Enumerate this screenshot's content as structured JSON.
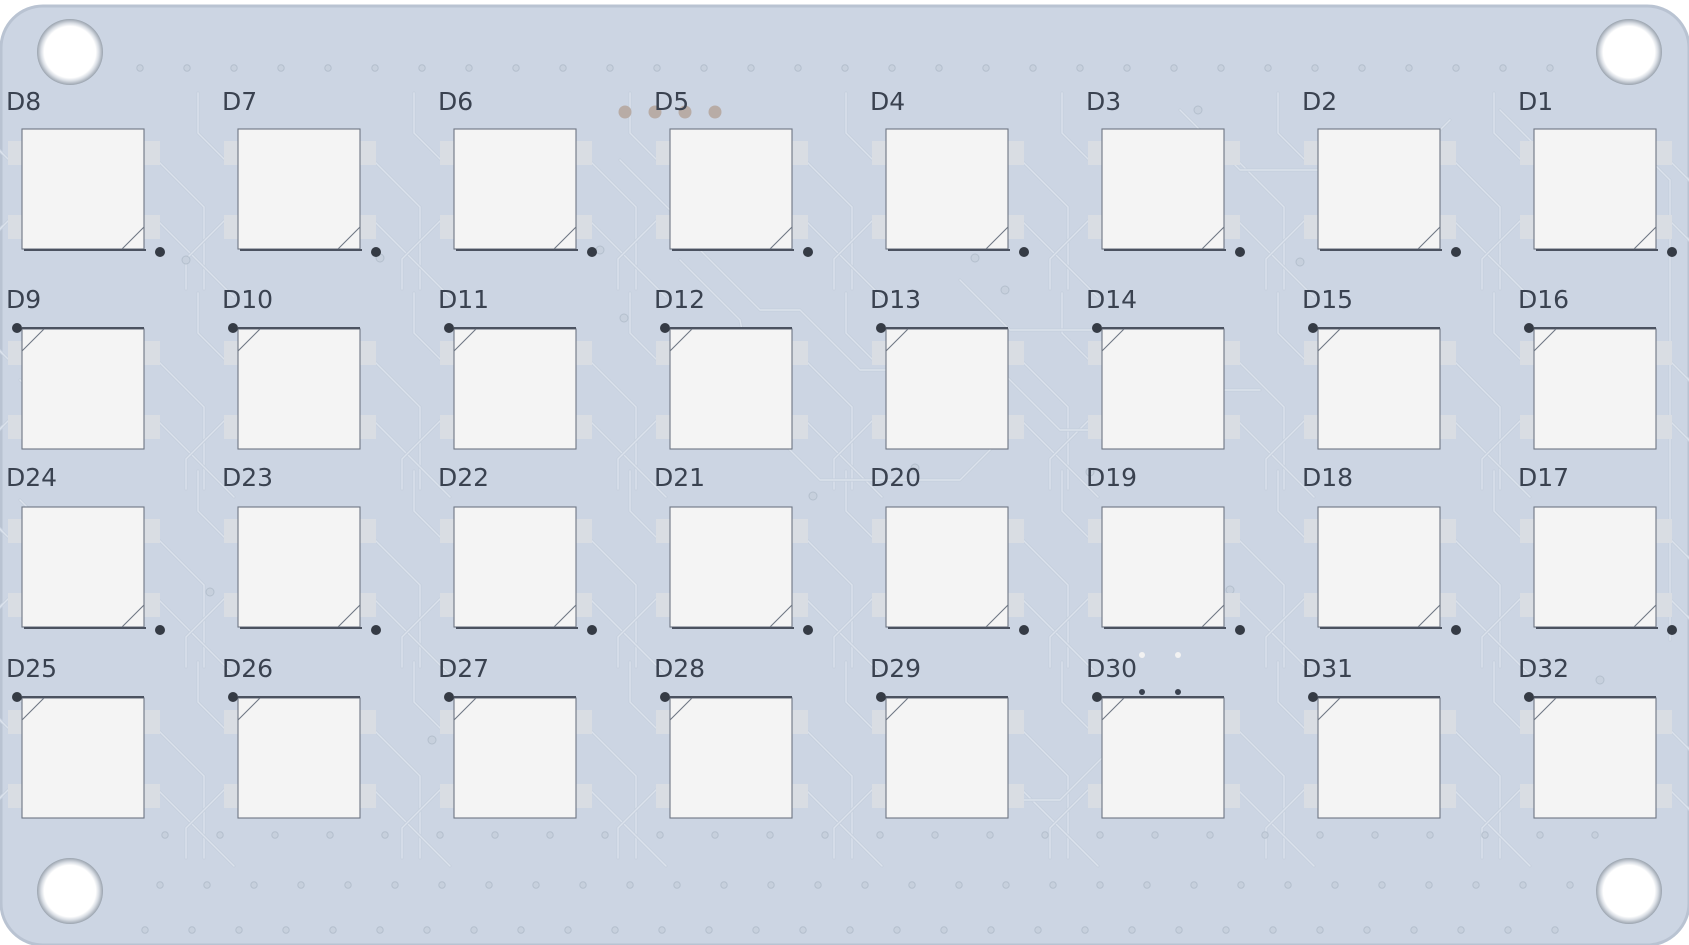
{
  "board": {
    "name": "LED matrix PCB (bottom view render)",
    "colors": {
      "substrate": "#ccd5e3",
      "substrate_edge": "#b9c3d2",
      "trace": "#c6d0de",
      "silkscreen": "#3a4250",
      "led_body": "#f4f4f4",
      "pad": "#d9dde3",
      "mounting_hole": "#ffffff"
    },
    "mounting_holes": 4,
    "grid": {
      "rows": 4,
      "columns": 8
    }
  },
  "leds": [
    {
      "ref": "D8",
      "pin1_corner": "bottom-right"
    },
    {
      "ref": "D7",
      "pin1_corner": "bottom-right"
    },
    {
      "ref": "D6",
      "pin1_corner": "bottom-right"
    },
    {
      "ref": "D5",
      "pin1_corner": "bottom-right"
    },
    {
      "ref": "D4",
      "pin1_corner": "bottom-right"
    },
    {
      "ref": "D3",
      "pin1_corner": "bottom-right"
    },
    {
      "ref": "D2",
      "pin1_corner": "bottom-right"
    },
    {
      "ref": "D1",
      "pin1_corner": "bottom-right"
    },
    {
      "ref": "D9",
      "pin1_corner": "top-left"
    },
    {
      "ref": "D10",
      "pin1_corner": "top-left"
    },
    {
      "ref": "D11",
      "pin1_corner": "top-left"
    },
    {
      "ref": "D12",
      "pin1_corner": "top-left"
    },
    {
      "ref": "D13",
      "pin1_corner": "top-left"
    },
    {
      "ref": "D14",
      "pin1_corner": "top-left"
    },
    {
      "ref": "D15",
      "pin1_corner": "top-left"
    },
    {
      "ref": "D16",
      "pin1_corner": "top-left"
    },
    {
      "ref": "D24",
      "pin1_corner": "bottom-right"
    },
    {
      "ref": "D23",
      "pin1_corner": "bottom-right"
    },
    {
      "ref": "D22",
      "pin1_corner": "bottom-right"
    },
    {
      "ref": "D21",
      "pin1_corner": "bottom-right"
    },
    {
      "ref": "D20",
      "pin1_corner": "bottom-right"
    },
    {
      "ref": "D19",
      "pin1_corner": "bottom-right"
    },
    {
      "ref": "D18",
      "pin1_corner": "bottom-right"
    },
    {
      "ref": "D17",
      "pin1_corner": "bottom-right"
    },
    {
      "ref": "D25",
      "pin1_corner": "top-left"
    },
    {
      "ref": "D26",
      "pin1_corner": "top-left"
    },
    {
      "ref": "D27",
      "pin1_corner": "top-left"
    },
    {
      "ref": "D28",
      "pin1_corner": "top-left"
    },
    {
      "ref": "D29",
      "pin1_corner": "top-left"
    },
    {
      "ref": "D30",
      "pin1_corner": "top-left"
    },
    {
      "ref": "D31",
      "pin1_corner": "top-left"
    },
    {
      "ref": "D32",
      "pin1_corner": "top-left"
    }
  ]
}
